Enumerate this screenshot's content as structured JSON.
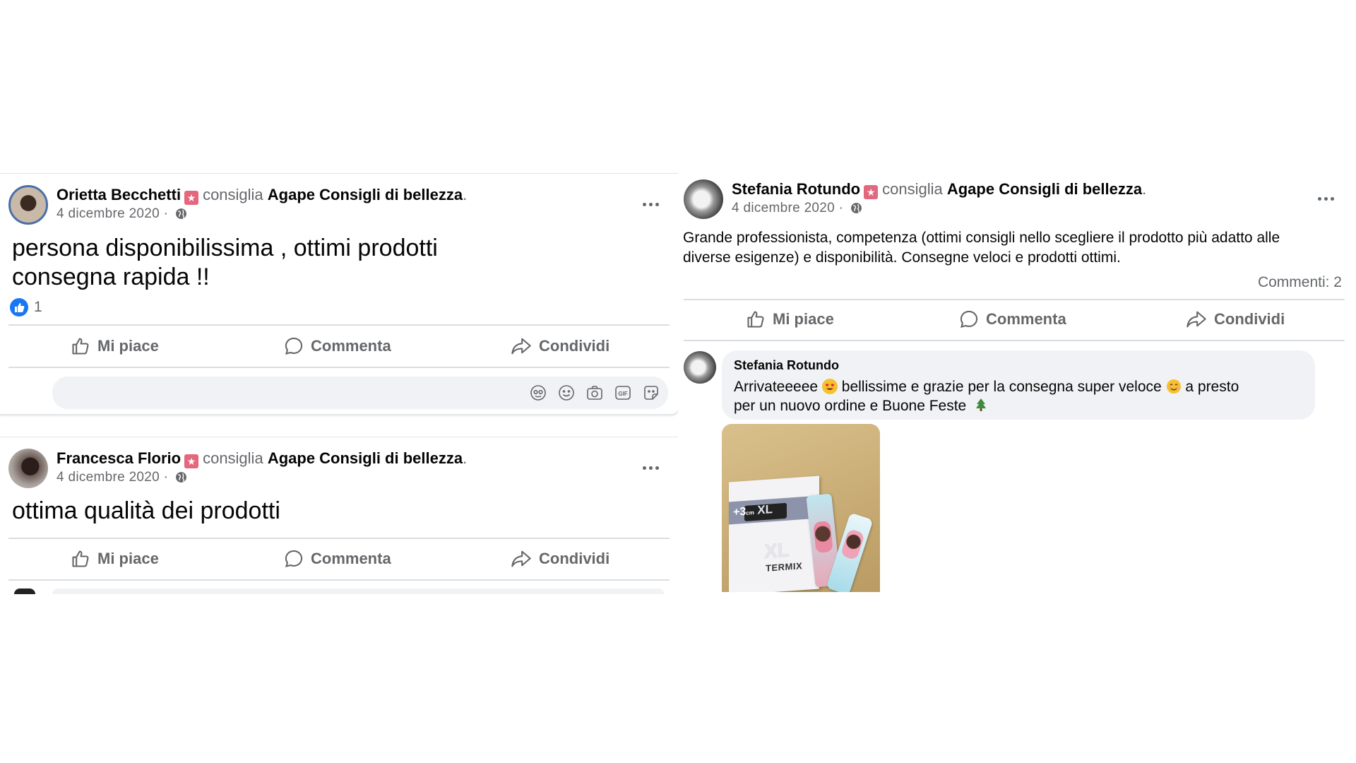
{
  "posts": [
    {
      "author": "Orietta Becchetti",
      "verb": "consiglia",
      "page": "Agape Consigli di bellezza",
      "date": "4 dicembre 2020 ·",
      "text_line1": "persona disponibilissima , ottimi prodotti",
      "text_line2": "consegna rapida !!",
      "likes": "1"
    },
    {
      "author": "Francesca Florio",
      "verb": "consiglia",
      "page": "Agape Consigli di bellezza",
      "date": "4 dicembre 2020 ·",
      "text_line1": "ottima qualità dei prodotti"
    },
    {
      "author": "Stefania Rotundo",
      "verb": "consiglia",
      "page": "Agape Consigli di bellezza",
      "date": "4 dicembre 2020 ·",
      "text_line1": "Grande professionista, competenza (ottimi consigli nello scegliere il prodotto più adatto alle",
      "text_line2": "diverse esigenze) e disponibilità. Consegne veloci e prodotti ottimi.",
      "comments_count": "Commenti: 2"
    }
  ],
  "actions": {
    "like": "Mi piace",
    "comment": "Commenta",
    "share": "Condividi"
  },
  "reply": {
    "author": "Stefania Rotundo",
    "text_a": "Arrivateeeee",
    "text_b": "bellissime e grazie per la consegna super veloce",
    "text_c": "a presto",
    "text_line2": "per un nuovo ordine e Buone Feste"
  },
  "photo": {
    "box_label": "+3",
    "box_label_unit": "cm",
    "box_label_xl": "XL",
    "brand_xl": "XL",
    "brand": "TERMIX"
  },
  "icons": {
    "like_badge": "like-badge-icon",
    "globe": "globe-icon",
    "more": "more-options-icon",
    "thumb": "thumbs-up-icon",
    "comment": "comment-icon",
    "share": "share-icon",
    "avatar_sticker": "avatar-sticker-icon",
    "emoji": "emoji-icon",
    "camera": "camera-icon",
    "gif": "gif-icon",
    "sticker": "sticker-icon",
    "heart_eyes": "heart-eyes-emoji",
    "smile": "smiling-emoji",
    "tree": "christmas-tree-emoji"
  },
  "colors": {
    "badge": "#e4687d",
    "like_blue": "#1877f2",
    "secondary_text": "#65676b",
    "divider": "#dadde1",
    "bubble_bg": "#f0f2f5"
  }
}
